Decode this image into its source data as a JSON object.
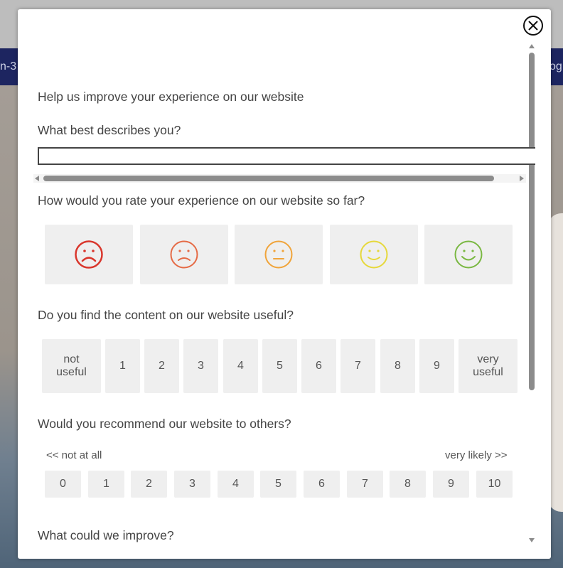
{
  "background": {
    "nav_left_text": "n-3",
    "nav_right_text": "og"
  },
  "survey": {
    "intro": "Help us improve your experience on our website",
    "q1": {
      "label": "What best describes you?",
      "value": ""
    },
    "q2": {
      "label": "How would you rate your experience on our website so far?",
      "faces": [
        {
          "icon": "very-sad-face-icon",
          "color": "#d9362c"
        },
        {
          "icon": "sad-face-icon",
          "color": "#e56a45"
        },
        {
          "icon": "neutral-face-icon",
          "color": "#f0a43a"
        },
        {
          "icon": "happy-face-icon",
          "color": "#e6d83a"
        },
        {
          "icon": "very-happy-face-icon",
          "color": "#7ab842"
        }
      ]
    },
    "q3": {
      "label": "Do you find the content on our website useful?",
      "low_line1": "not",
      "low_line2": "useful",
      "numbers": [
        "1",
        "2",
        "3",
        "4",
        "5",
        "6",
        "7",
        "8",
        "9"
      ],
      "high_line1": "very",
      "high_line2": "useful"
    },
    "q4": {
      "label": "Would you recommend our website to others?",
      "low_label": "<< not at all",
      "high_label": "very likely >>",
      "numbers": [
        "0",
        "1",
        "2",
        "3",
        "4",
        "5",
        "6",
        "7",
        "8",
        "9",
        "10"
      ]
    },
    "q5": {
      "label": "What could we improve?"
    }
  }
}
